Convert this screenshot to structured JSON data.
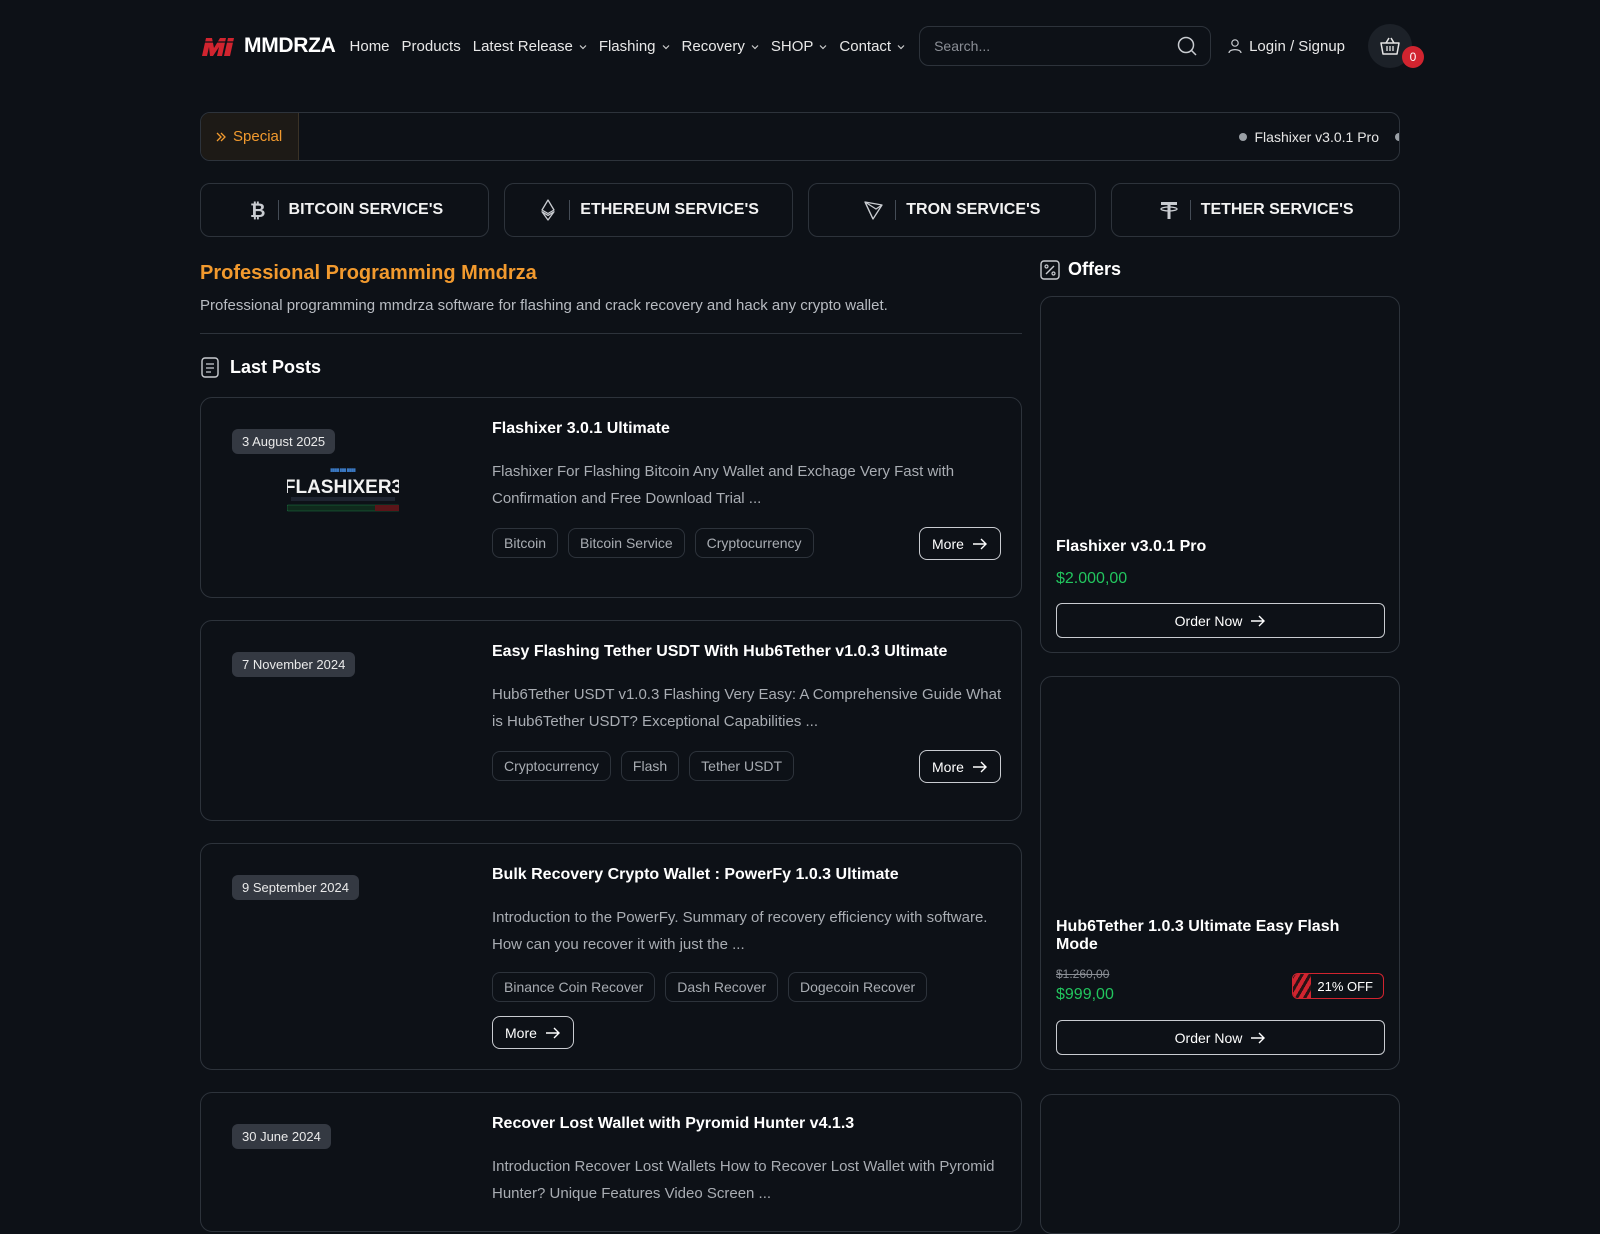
{
  "brand": {
    "name": "MMDRZA",
    "accent": "#f29a2e",
    "logo_color": "#d1242f"
  },
  "nav": [
    {
      "label": "Home",
      "dropdown": false
    },
    {
      "label": "Products",
      "dropdown": false
    },
    {
      "label": "Latest Release",
      "dropdown": true
    },
    {
      "label": "Flashing",
      "dropdown": true
    },
    {
      "label": "Recovery",
      "dropdown": true
    },
    {
      "label": "SHOP",
      "dropdown": true
    },
    {
      "label": "Contact",
      "dropdown": true
    }
  ],
  "search": {
    "placeholder": "Search..."
  },
  "account": {
    "login_label": "Login / Signup"
  },
  "cart": {
    "count": "0"
  },
  "special": {
    "label": "Special",
    "ticker_item": "Flashixer v3.0.1 Pro"
  },
  "services": [
    {
      "label": "BITCOIN SERVICE'S",
      "icon": "bitcoin-icon"
    },
    {
      "label": "ETHEREUM SERVICE'S",
      "icon": "ethereum-icon"
    },
    {
      "label": "TRON SERVICE'S",
      "icon": "tron-icon"
    },
    {
      "label": "TETHER SERVICE'S",
      "icon": "tether-icon"
    }
  ],
  "main": {
    "title": "Professional Programming Mmdrza",
    "description": "Professional programming mmdrza software for flashing and crack recovery and hack any crypto wallet.",
    "posts_heading": "Last Posts"
  },
  "posts": [
    {
      "date": "3 August 2025",
      "title": "Flashixer 3.0.1 Ultimate",
      "excerpt": "Flashixer For Flashing Bitcoin Any Wallet and Exchage Very Fast with Confirmation and Free Download Trial ...",
      "tags": [
        "Bitcoin",
        "Bitcoin Service",
        "Cryptocurrency"
      ],
      "more_label": "More",
      "thumb_text": "FLASHIXER3"
    },
    {
      "date": "7 November 2024",
      "title": "Easy Flashing Tether USDT With Hub6Tether v1.0.3 Ultimate",
      "excerpt": "Hub6Tether USDT v1.0.3 Flashing Very Easy: A Comprehensive Guide What is Hub6Tether USDT? Exceptional Capabilities ...",
      "tags": [
        "Cryptocurrency",
        "Flash",
        "Tether USDT"
      ],
      "more_label": "More"
    },
    {
      "date": "9 September 2024",
      "title": "Bulk Recovery Crypto Wallet : PowerFy 1.0.3 Ultimate",
      "excerpt": "Introduction to the PowerFy. Summary of recovery efficiency with software. How can you recover it with just the ...",
      "tags": [
        "Binance Coin Recover",
        "Dash Recover",
        "Dogecoin Recover"
      ],
      "more_label": "More"
    },
    {
      "date": "30 June 2024",
      "title": "Recover Lost Wallet with Pyromid Hunter v4.1.3",
      "excerpt": "Introduction Recover Lost Wallets How to Recover Lost Wallet with Pyromid Hunter? Unique Features Video Screen ..."
    }
  ],
  "offers": {
    "heading": "Offers",
    "items": [
      {
        "name": "Flashixer v3.0.1 Pro",
        "price": "$2.000,00",
        "order_label": "Order Now"
      },
      {
        "name": "Hub6Tether 1.0.3 Ultimate Easy Flash Mode",
        "old_price": "$1.260,00",
        "price": "$999,00",
        "discount": "21% OFF",
        "order_label": "Order Now"
      }
    ]
  },
  "colors": {
    "background": "#0d1117",
    "border": "#2d333b",
    "price_green": "#22c55e",
    "badge_red": "#d1242f"
  }
}
